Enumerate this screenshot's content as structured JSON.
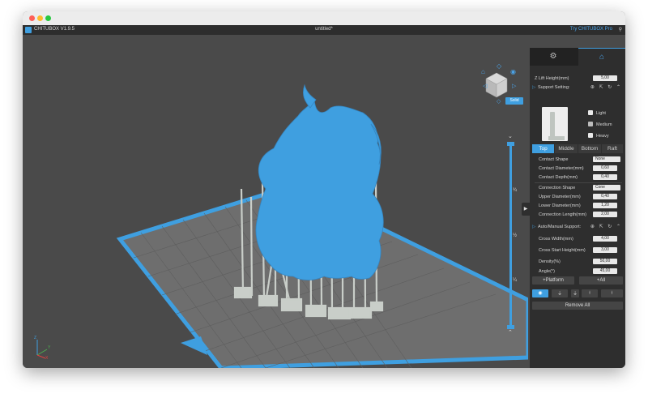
{
  "window": {
    "app_name": "CHITUBOX V1.9.5",
    "doc_title": "untitled*",
    "try_pro": "Try CHITUBOX Pro"
  },
  "viewport": {
    "solid_label": "Solid",
    "slider_marks": [
      "¾",
      "½",
      "¼"
    ],
    "axes": {
      "x": "X",
      "y": "Y",
      "z": "Z"
    },
    "accent_color": "#3f9fe0",
    "model_color": "#3f9fe0",
    "support_color": "#c9cec9"
  },
  "panel": {
    "tabs": [
      {
        "icon": "gear-icon",
        "active": false
      },
      {
        "icon": "support-columns-icon",
        "active": true
      }
    ],
    "z_lift_label": "Z Lift Height(mm)",
    "z_lift_value": "5,00",
    "support_setting": "Support Setting:",
    "density": {
      "light": "Light",
      "medium": "Medium",
      "heavy": "Heavy",
      "selected": "Medium"
    },
    "segments": [
      "Top",
      "Middle",
      "Bottom",
      "Raft"
    ],
    "active_segment": "Top",
    "contact_shape_label": "Contact Shape",
    "contact_shape_value": "None",
    "contact_diameter_label": "Contact Diameter(mm)",
    "contact_diameter_value": "0,60",
    "contact_depth_label": "Contact Depth(mm)",
    "contact_depth_value": "0,40",
    "connection_shape_label": "Connection Shape",
    "connection_shape_value": "Cone",
    "upper_diameter_label": "Upper Diameter(mm)",
    "upper_diameter_value": "0,40",
    "lower_diameter_label": "Lower Diameter(mm)",
    "lower_diameter_value": "1,20",
    "connection_length_label": "Connection Length(mm)",
    "connection_length_value": "2,00",
    "auto_manual_label": "Auto/Manual Support:",
    "cross_width_label": "Cross Width(mm)",
    "cross_width_value": "4,00",
    "cross_start_label": "Cross Start Height(mm)",
    "cross_start_value": "3,00",
    "density_label": "Density(%)",
    "density_value": "50,00",
    "angle_label": "Angle(°)",
    "angle_value": "45,00",
    "platform_button": "+Platform",
    "all_button": "+All",
    "remove_all_button": "Remove All"
  }
}
